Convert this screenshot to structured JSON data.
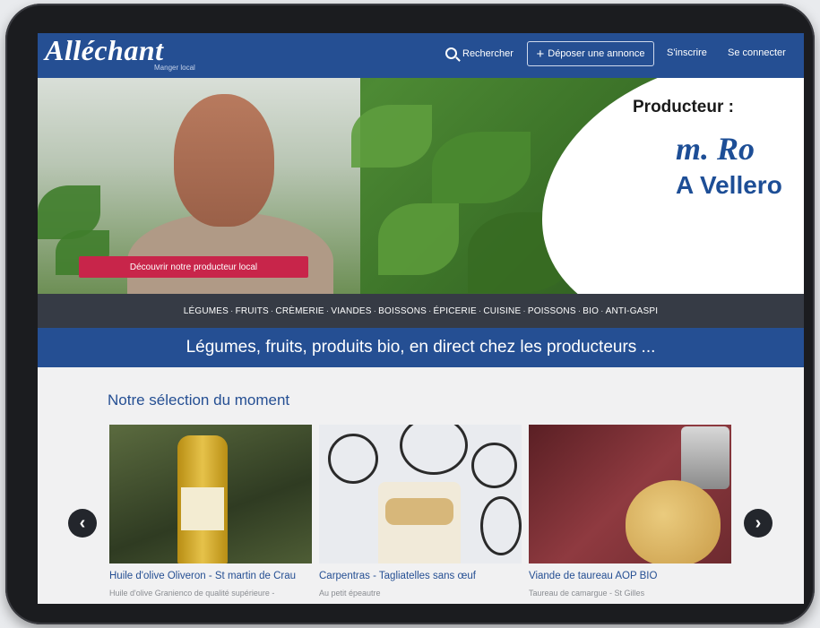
{
  "header": {
    "logo": "Alléchant",
    "tagline": "Manger local",
    "search_label": "Rechercher",
    "post_label": "Déposer une annonce",
    "signup_label": "S'inscrire",
    "login_label": "Se connecter"
  },
  "hero": {
    "title": "Producteur :",
    "name": "m. Ro",
    "place": "A Vellero",
    "button_label": "Découvrir notre producteur local"
  },
  "categories": [
    "LÉGUMES",
    "FRUITS",
    "CRÈMERIE",
    "VIANDES",
    "BOISSONS",
    "ÉPICERIE",
    "CUISINE",
    "POISSONS",
    "BIO",
    "ANTI-GASPI"
  ],
  "slogan": "Légumes, fruits, produits bio, en direct chez les producteurs ...",
  "selection": {
    "title": "Notre sélection du moment",
    "products": [
      {
        "name": "Huile d'olive Oliveron - St martin de Crau",
        "subtitle": "Huile d'olive Granienco de qualité supérieure -"
      },
      {
        "name": "Carpentras - Tagliatelles sans œuf",
        "subtitle": "Au petit épeautre"
      },
      {
        "name": "Viande de taureau AOP BIO",
        "subtitle": "Taureau de camargue - St Gilles"
      }
    ],
    "prev_icon": "‹",
    "next_icon": "›"
  },
  "colors": {
    "brand_blue": "#254f93",
    "dark_bar": "#363b45",
    "accent_pink": "#c8254a"
  }
}
